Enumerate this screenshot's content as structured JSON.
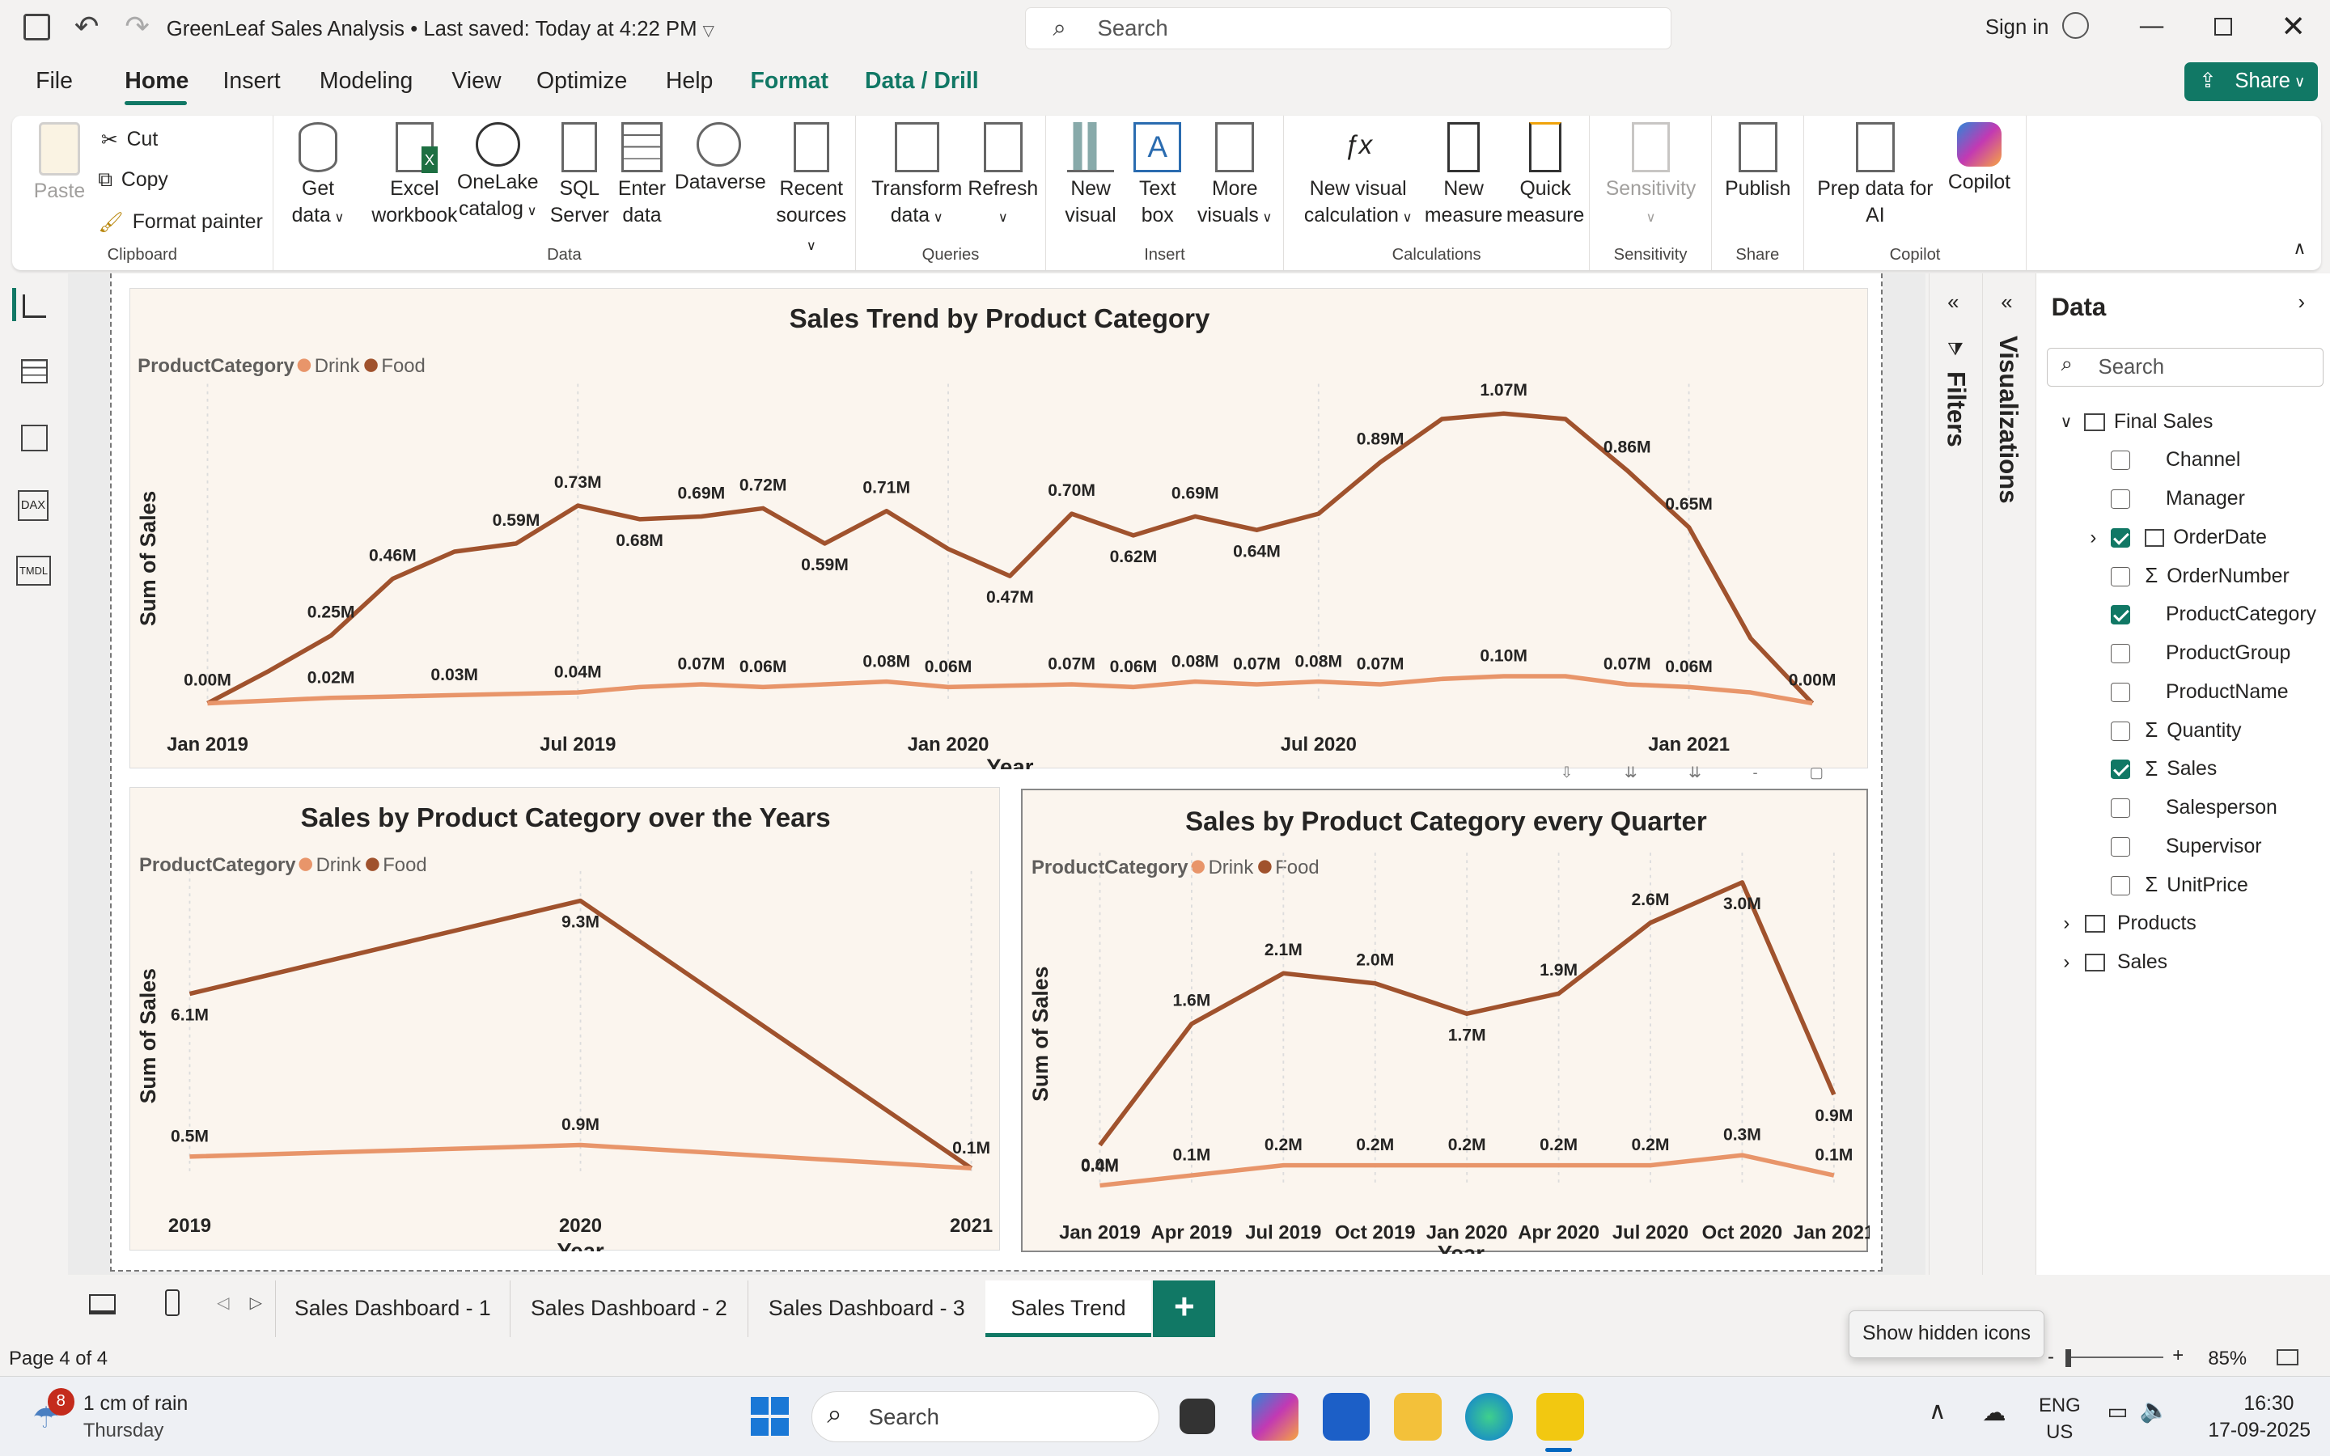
{
  "window": {
    "title": "GreenLeaf Sales Analysis",
    "saved": " • Last saved: Today at 4:22 PM",
    "search_placeholder": "Search",
    "sign_in": "Sign in"
  },
  "menu": {
    "items": [
      "File",
      "Home",
      "Insert",
      "Modeling",
      "View",
      "Optimize",
      "Help",
      "Format",
      "Data / Drill"
    ],
    "active": "Home",
    "share": "Share"
  },
  "ribbon": {
    "clipboard": {
      "paste": "Paste",
      "cut": "Cut",
      "copy": "Copy",
      "format_painter": "Format painter",
      "label": "Clipboard"
    },
    "data": {
      "get_data": [
        "Get",
        "data"
      ],
      "excel": [
        "Excel",
        "workbook"
      ],
      "onelake": [
        "OneLake",
        "catalog"
      ],
      "sql": [
        "SQL",
        "Server"
      ],
      "enter": [
        "Enter",
        "data"
      ],
      "dataverse": [
        "Dataverse",
        ""
      ],
      "recent": [
        "Recent",
        "sources"
      ],
      "label": "Data"
    },
    "queries": {
      "transform": [
        "Transform",
        "data"
      ],
      "refresh": [
        "Refresh",
        ""
      ],
      "label": "Queries"
    },
    "insert": {
      "new_visual": [
        "New",
        "visual"
      ],
      "text_box": [
        "Text",
        "box"
      ],
      "more": [
        "More",
        "visuals"
      ],
      "label": "Insert"
    },
    "calculations": {
      "nvc": [
        "New visual",
        "calculation"
      ],
      "nm": [
        "New",
        "measure"
      ],
      "qm": [
        "Quick",
        "measure"
      ],
      "label": "Calculations"
    },
    "sensitivity": {
      "btn": [
        "Sensitivity",
        ""
      ],
      "label": "Sensitivity"
    },
    "share": {
      "publish": [
        "Publish",
        ""
      ],
      "label": "Share"
    },
    "copilot": {
      "prep": [
        "Prep data for",
        "AI"
      ],
      "copilot": [
        "Copilot",
        ""
      ],
      "label": "Copilot"
    }
  },
  "panes": {
    "filters": "Filters",
    "visualizations": "Visualizations",
    "data_title": "Data",
    "data_search": "Search"
  },
  "data_fields": {
    "table": "Final Sales",
    "fields": [
      {
        "name": "Channel",
        "checked": false,
        "sigma": false
      },
      {
        "name": "Manager",
        "checked": false,
        "sigma": false
      },
      {
        "name": "OrderDate",
        "checked": true,
        "sigma": false,
        "expand": true,
        "date": true
      },
      {
        "name": "OrderNumber",
        "checked": false,
        "sigma": true
      },
      {
        "name": "ProductCategory",
        "checked": true,
        "sigma": false
      },
      {
        "name": "ProductGroup",
        "checked": false,
        "sigma": false
      },
      {
        "name": "ProductName",
        "checked": false,
        "sigma": false
      },
      {
        "name": "Quantity",
        "checked": false,
        "sigma": true
      },
      {
        "name": "Sales",
        "checked": true,
        "sigma": true
      },
      {
        "name": "Salesperson",
        "checked": false,
        "sigma": false
      },
      {
        "name": "Supervisor",
        "checked": false,
        "sigma": false
      },
      {
        "name": "UnitPrice",
        "checked": false,
        "sigma": true
      }
    ],
    "other_tables": [
      "Products",
      "Sales"
    ]
  },
  "page_tabs": [
    "Sales Dashboard - 1",
    "Sales Dashboard - 2",
    "Sales Dashboard - 3",
    "Sales Trend"
  ],
  "active_tab": "Sales Trend",
  "status": {
    "page": "Page 4 of 4",
    "zoom": "85%",
    "tooltip": "Show hidden icons"
  },
  "taskbar": {
    "weather_count": "8",
    "weather": "1 cm of rain",
    "day": "Thursday",
    "search": "Search",
    "lang": "ENG",
    "region": "US",
    "time": "16:30",
    "date": "17-09-2025"
  },
  "colors": {
    "food": "#a0522d",
    "drink": "#e8956a",
    "accent": "#117865"
  },
  "chart_data": [
    {
      "type": "line",
      "title": "Sales Trend by Product Category",
      "legend_title": "ProductCategory",
      "xlabel": "Year",
      "ylabel": "Sum of Sales",
      "x_ticks": [
        "Jan 2019",
        "Jul 2019",
        "Jan 2020",
        "Jul 2020",
        "Jan 2021"
      ],
      "series": [
        {
          "name": "Food",
          "values": [
            0.0,
            0.12,
            0.25,
            0.46,
            0.56,
            0.59,
            0.73,
            0.68,
            0.69,
            0.72,
            0.59,
            0.71,
            0.57,
            0.47,
            0.7,
            0.62,
            0.69,
            0.64,
            0.7,
            0.89,
            1.05,
            1.07,
            1.05,
            0.86,
            0.65,
            0.24,
            0.0
          ],
          "labels": [
            "0.00M",
            "",
            "0.25M",
            "0.46M",
            "",
            "0.59M",
            "0.73M",
            "0.68M",
            "0.69M",
            "0.72M",
            "0.59M",
            "0.71M",
            "",
            "0.47M",
            "0.70M",
            "0.62M",
            "0.69M",
            "0.64M",
            "",
            "0.89M",
            "",
            "1.07M",
            "",
            "0.86M",
            "0.65M",
            "",
            "0.00M"
          ]
        },
        {
          "name": "Drink",
          "values": [
            0.0,
            0.01,
            0.02,
            0.025,
            0.03,
            0.035,
            0.04,
            0.06,
            0.07,
            0.06,
            0.07,
            0.08,
            0.06,
            0.065,
            0.07,
            0.06,
            0.08,
            0.07,
            0.08,
            0.07,
            0.09,
            0.1,
            0.1,
            0.07,
            0.06,
            0.04,
            0.0
          ],
          "labels": [
            "",
            "",
            "0.02M",
            "",
            "0.03M",
            "",
            "0.04M",
            "",
            "0.07M",
            "0.06M",
            "",
            "0.08M",
            "0.06M",
            "",
            "0.07M",
            "0.06M",
            "0.08M",
            "0.07M",
            "0.08M",
            "0.07M",
            "",
            "0.10M",
            "",
            "0.07M",
            "0.06M",
            "",
            ""
          ]
        }
      ]
    },
    {
      "type": "line",
      "title": "Sales by Product Category over the Years",
      "legend_title": "ProductCategory",
      "xlabel": "Year",
      "ylabel": "Sum of Sales",
      "categories": [
        "2019",
        "2020",
        "2021"
      ],
      "series": [
        {
          "name": "Food",
          "values": [
            6.1,
            9.3,
            0.1
          ],
          "labels": [
            "6.1M",
            "9.3M",
            ""
          ]
        },
        {
          "name": "Drink",
          "values": [
            0.5,
            0.9,
            0.1
          ],
          "labels": [
            "0.5M",
            "0.9M",
            "0.1M"
          ]
        }
      ]
    },
    {
      "type": "line",
      "title": "Sales by Product Category every Quarter",
      "legend_title": "ProductCategory",
      "xlabel": "Year",
      "ylabel": "Sum of Sales",
      "categories": [
        "Jan 2019",
        "Apr 2019",
        "Jul 2019",
        "Oct 2019",
        "Jan 2020",
        "Apr 2020",
        "Jul 2020",
        "Oct 2020",
        "Jan 2021"
      ],
      "series": [
        {
          "name": "Food",
          "values": [
            0.4,
            1.6,
            2.1,
            2.0,
            1.7,
            1.9,
            2.6,
            3.0,
            0.9
          ],
          "labels": [
            "0.4M",
            "1.6M",
            "2.1M",
            "2.0M",
            "1.7M",
            "1.9M",
            "2.6M",
            "3.0M",
            "0.9M"
          ]
        },
        {
          "name": "Drink",
          "values": [
            0.0,
            0.1,
            0.2,
            0.2,
            0.2,
            0.2,
            0.2,
            0.3,
            0.1
          ],
          "labels": [
            "0.0M",
            "0.1M",
            "0.2M",
            "0.2M",
            "0.2M",
            "0.2M",
            "0.2M",
            "0.3M",
            "0.1M"
          ]
        }
      ]
    }
  ]
}
